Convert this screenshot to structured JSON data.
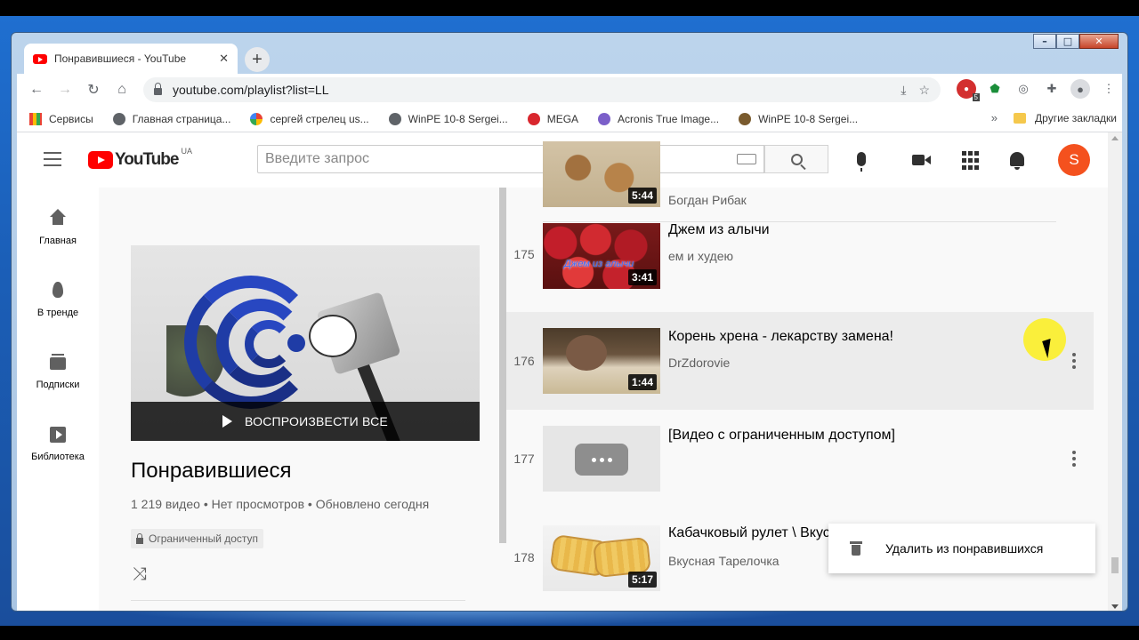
{
  "browser": {
    "tab_title": "Понравившиеся - YouTube",
    "tab_close": "✕",
    "new_tab": "+",
    "url": "youtube.com/playlist?list=LL",
    "bookmarks": [
      {
        "label": "Сервисы",
        "color": "#ea4335"
      },
      {
        "label": "Главная страница...",
        "color": "#5f6368"
      },
      {
        "label": "сергей стрелец us...",
        "color": "#4285f4"
      },
      {
        "label": "WinPE 10-8 Sergei...",
        "color": "#5f6368"
      },
      {
        "label": "MEGA",
        "color": "#d9272e"
      },
      {
        "label": "Acronis True Image...",
        "color": "#7b5fc9"
      },
      {
        "label": "WinPE 10-8 Sergei...",
        "color": "#3b2b1b"
      }
    ],
    "bookmarks_more": "»",
    "other_bookmarks": "Другие закладки",
    "ext_badge": "5"
  },
  "youtube": {
    "logo_text": "YouTube",
    "logo_region": "UA",
    "search_placeholder": "Введите запрос",
    "avatar_letter": "S",
    "guide": [
      {
        "label": "Главная",
        "icon": "home-icon"
      },
      {
        "label": "В тренде",
        "icon": "trending-icon"
      },
      {
        "label": "Подписки",
        "icon": "subscriptions-icon"
      },
      {
        "label": "Библиотека",
        "icon": "library-icon"
      }
    ],
    "playlist": {
      "play_all": "ВОСПРОИЗВЕСТИ ВСЕ",
      "title": "Понравившиеся",
      "stats": "1 219 видео • Нет просмотров • Обновлено сегодня",
      "privacy": "Ограниченный доступ"
    },
    "videos": [
      {
        "index": "",
        "title": "",
        "channel": "Богдан Рибак",
        "duration": "5:44"
      },
      {
        "index": "175",
        "title": "Джем из алычи",
        "channel": "ем и худею",
        "duration": "3:41",
        "overlay_text": "Джем из алычи"
      },
      {
        "index": "176",
        "title": "Корень хрена - лекарству замена!",
        "channel": "DrZdorovie",
        "duration": "1:44"
      },
      {
        "index": "177",
        "title": "[Видео с ограниченным доступом]",
        "channel": "",
        "duration": ""
      },
      {
        "index": "178",
        "title": "Кабачковый рулет \\ Вкусная закуска из кабачка",
        "channel": "Вкусная Тарелочка",
        "duration": "5:17"
      }
    ],
    "context_menu": {
      "remove_label": "Удалить из понравившихся"
    }
  },
  "colors": {
    "youtube_red": "#ff0000",
    "avatar": "#f4511e",
    "highlight": "#fff000"
  }
}
